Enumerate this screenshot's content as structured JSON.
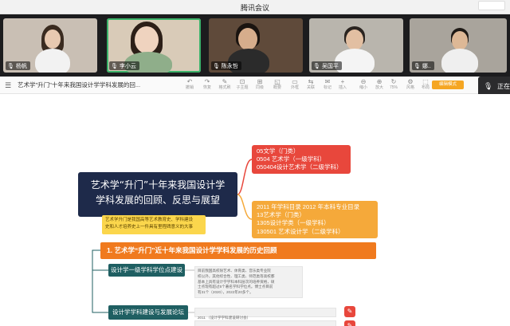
{
  "window": {
    "title": "腾讯会议"
  },
  "participants": [
    {
      "name": "杨帆",
      "mic_icon": "mic-icon"
    },
    {
      "name": "李小云",
      "mic_icon": "mic-icon"
    },
    {
      "name": "陈永哲",
      "mic_icon": "mic-icon"
    },
    {
      "name": "吴国平",
      "mic_icon": "mic-icon"
    },
    {
      "name": "娜..",
      "mic_icon": "mic-icon"
    }
  ],
  "toolbar": {
    "doc_title": "艺术学\"升门\"十年来我国设计学学科发展的回...",
    "buttons": [
      {
        "glyph": "↶",
        "label": "撤销"
      },
      {
        "glyph": "↷",
        "label": "恢复"
      },
      {
        "glyph": "✎",
        "label": "格式刷"
      },
      {
        "glyph": "⊡",
        "label": "子主题"
      },
      {
        "glyph": "⊞",
        "label": "同级"
      },
      {
        "glyph": "◱",
        "label": "概要"
      },
      {
        "glyph": "▭",
        "label": "外框"
      },
      {
        "glyph": "⇆",
        "label": "关联"
      },
      {
        "glyph": "✉",
        "label": "标记"
      },
      {
        "glyph": "+",
        "label": "插入"
      },
      {
        "glyph": "⊖",
        "label": "缩小"
      },
      {
        "glyph": "⊕",
        "label": "放大"
      },
      {
        "glyph": "↻",
        "label": "75%"
      },
      {
        "glyph": "⚙",
        "label": "风格"
      },
      {
        "glyph": "⬚",
        "label": "布局"
      }
    ],
    "share_label": "编辑模式"
  },
  "right_panel": {
    "text": "正在"
  },
  "mindmap": {
    "central_topic": [
      "艺术学“升门”十年来我国设计学",
      "学科发展的回顾、反思与展望"
    ],
    "red_node": [
      "05文学（门类）",
      "0504 艺术学（一级学科）",
      "050404设计艺术学（二级学科）"
    ],
    "orange_node": [
      "2011 年学科目录 2012 年本科专业目录",
      "13艺术学（门类）",
      "1305设计学类（一级学科）",
      "130501 艺术设计学（二级学科）"
    ],
    "yellow_note": [
      "艺术学升门是我国高等艺术教育史、学科建设",
      "史和人才培养史上一件具有里程碑意义的大事"
    ],
    "section_title": "1. 艺术学“升门”近十年来我国设计学学科发展的历史回顾",
    "teal_nodes": [
      "设计学一级学科学位点建设",
      "设计学学科建设与发展论坛"
    ],
    "info_box": [
      "目前我国高校除艺术、体育类、音乐类专业院",
      "校以外，其他综合性、理工类、师范类等高校都",
      "基本上具有设计学学科本科层次的培养资格，硕",
      "士点现有超过5个著名学科学位点。博士点目前",
      "有31个（2020），2022年20多个。"
    ],
    "entry_text": "2011 （设计学学科建设研讨会）"
  },
  "colors": {
    "central": "#1e2a4a",
    "red": "#e8473c",
    "orange": "#f5a93a",
    "yellow": "#fbd64c",
    "section": "#f07a1e",
    "teal": "#1f5f62",
    "active_speaker": "#3bb36a"
  }
}
